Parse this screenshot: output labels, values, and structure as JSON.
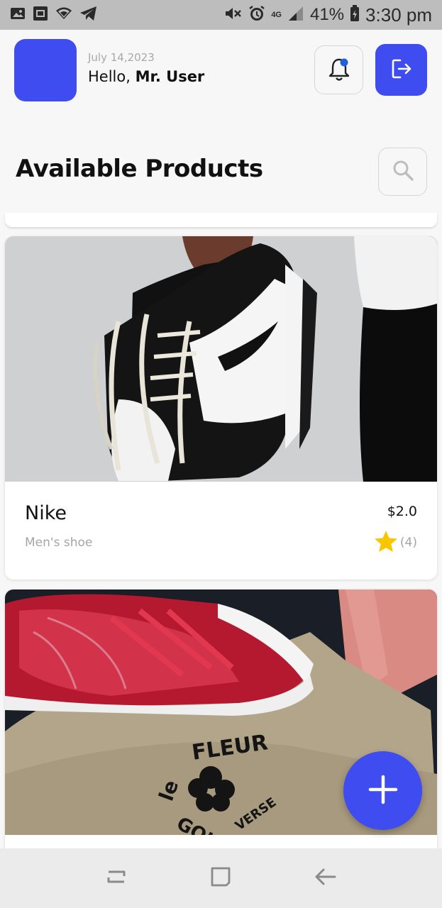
{
  "status_bar": {
    "left_icons": [
      "image-icon",
      "screenshot-icon",
      "wifi-icon",
      "telegram-icon"
    ],
    "right_icons": [
      "mute-icon",
      "alarm-icon",
      "network-4g-icon",
      "signal-icon",
      "battery-icon"
    ],
    "network": "4G",
    "battery": "41%",
    "time": "3:30 pm"
  },
  "header": {
    "avatar_color": "#3f4cf0",
    "date": "July 14,2023",
    "greeting_prefix": "Hello,",
    "user_name": "Mr. User",
    "notification_icon": "bell-icon",
    "notification_dot_color": "#1e63d6",
    "logout_icon": "logout-icon"
  },
  "page": {
    "title": "Available Products",
    "search_icon": "search-icon"
  },
  "products": [
    {
      "name": "Nike",
      "category": "Men's shoe",
      "price": "$2.0",
      "rating_icon": "star-icon",
      "rating_count": "(4)"
    },
    {
      "name": "",
      "category": "",
      "price": "",
      "rating_count": ""
    }
  ],
  "fab": {
    "icon": "plus-icon"
  },
  "nav_bar": {
    "items": [
      "recent-apps-icon",
      "home-icon",
      "back-icon"
    ]
  },
  "colors": {
    "accent": "#3f4cf0",
    "star": "#f7c600",
    "muted_text": "#a5a5a5"
  }
}
